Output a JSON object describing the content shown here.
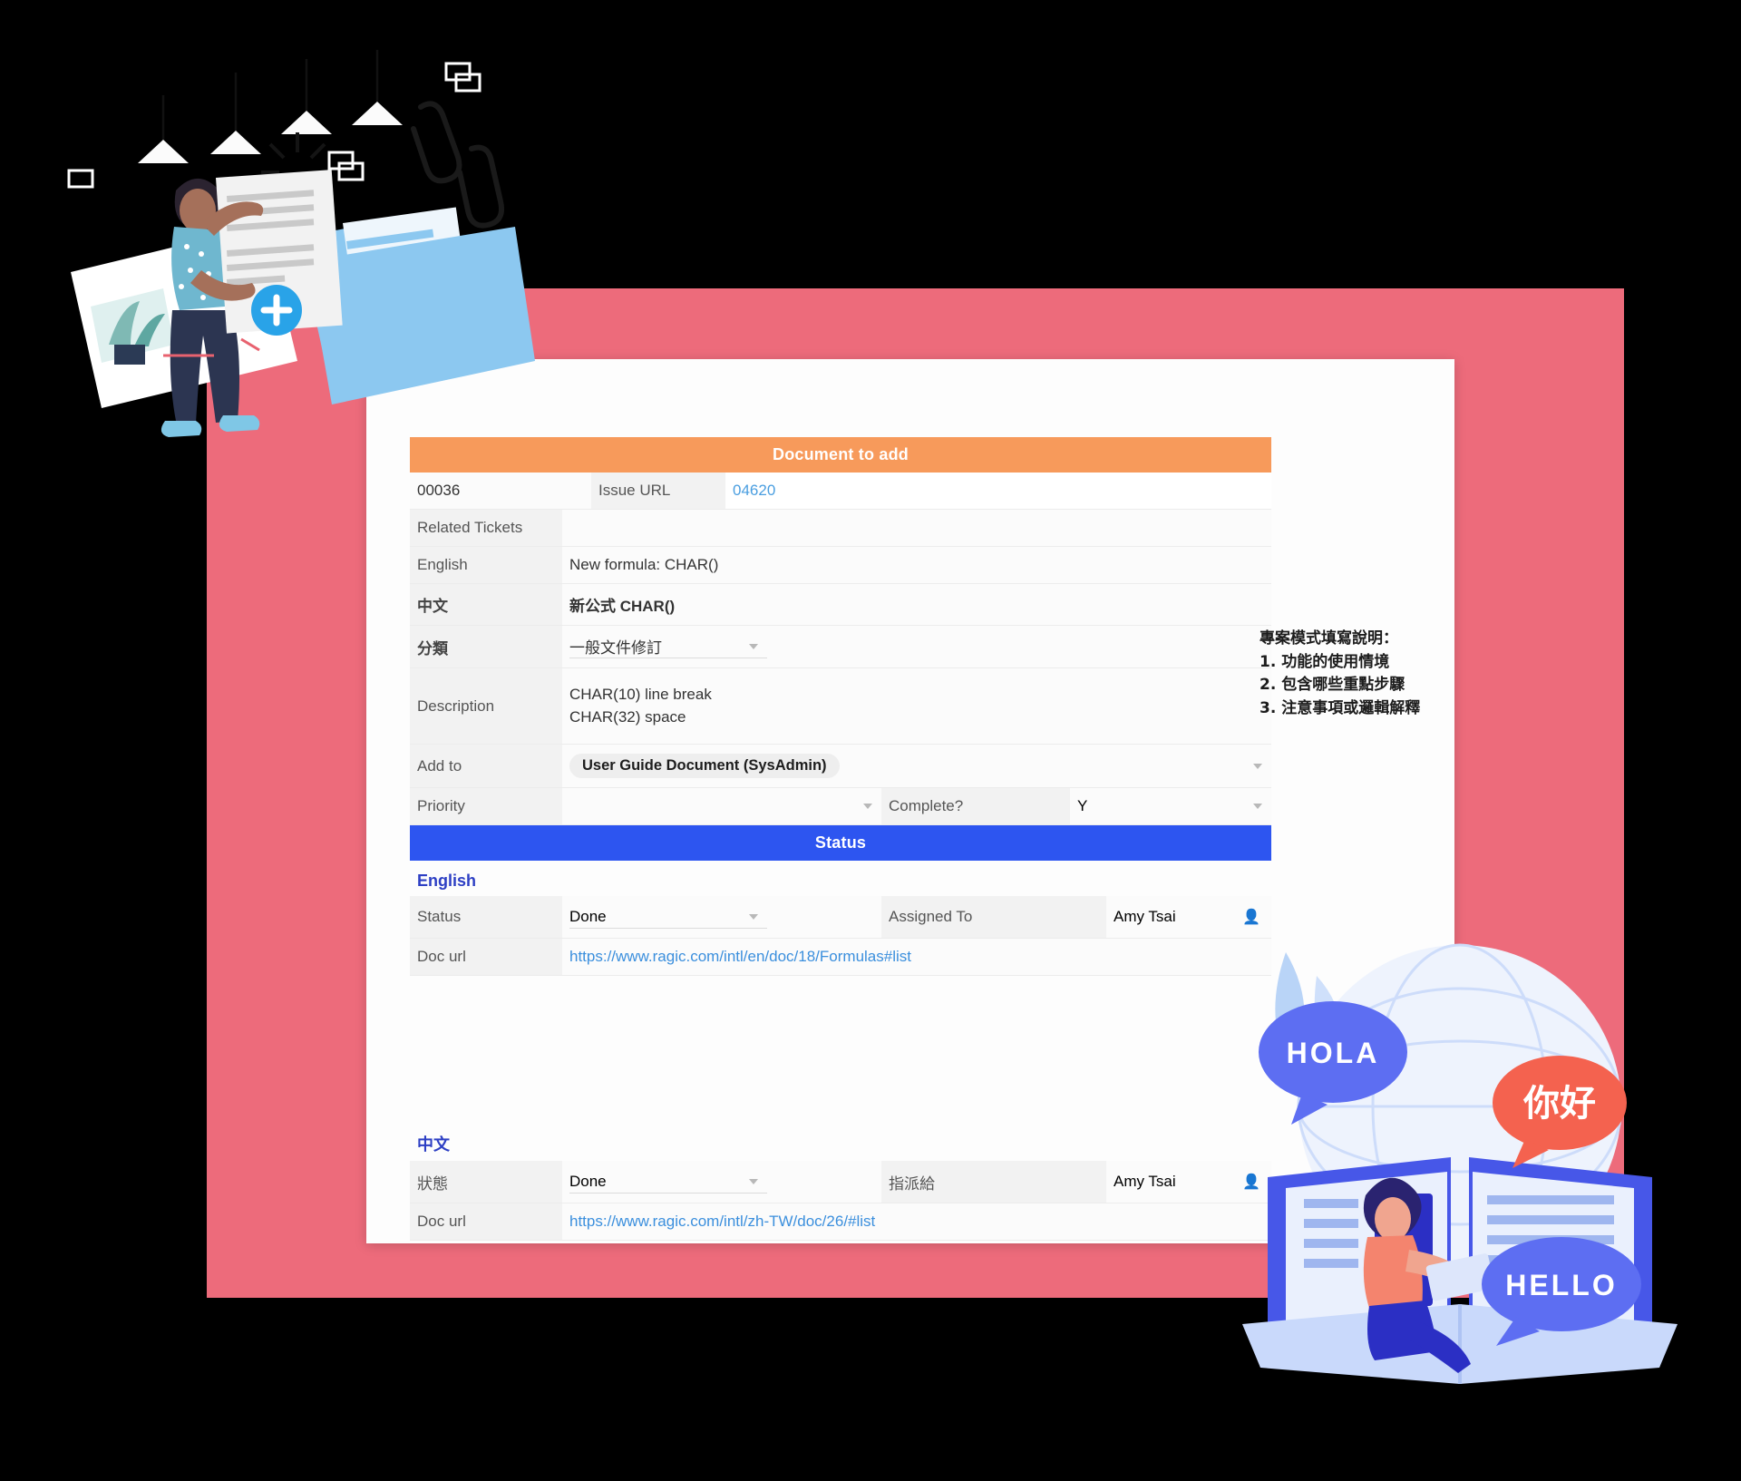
{
  "page": {
    "background_color": "#000000",
    "panel_color": "#ed6b7b",
    "card_color": "#fdfdfd"
  },
  "form": {
    "header_bar": "Document to add",
    "header_bar_color": "#f79a5b",
    "id_row": {
      "record_id": "00036",
      "issue_url_label": "Issue URL",
      "issue_url_value": "04620"
    },
    "rows": [
      {
        "label": "Related Tickets",
        "value": ""
      },
      {
        "label": "English",
        "value": "New formula: CHAR()"
      },
      {
        "label": "中文",
        "value": "新公式 CHAR()"
      }
    ],
    "category": {
      "label": "分類",
      "value": "一般文件修訂"
    },
    "description": {
      "label": "Description",
      "line1": "CHAR(10) line break",
      "line2": "CHAR(32) space"
    },
    "add_to": {
      "label": "Add to",
      "value": "User Guide Document (SysAdmin)"
    },
    "priority": {
      "label": "Priority",
      "value": ""
    },
    "complete": {
      "label": "Complete?",
      "value": "Y"
    },
    "status_bar": "Status",
    "status_bar_color": "#2d55f0",
    "sections": [
      {
        "heading": "English",
        "status_label": "Status",
        "status_value": "Done",
        "assigned_label": "Assigned To",
        "assigned_value": "Amy Tsai",
        "doc_url_label": "Doc url",
        "doc_url_value": "https://www.ragic.com/intl/en/doc/18/Formulas#list"
      },
      {
        "heading": "中文",
        "status_label": "狀態",
        "status_value": "Done",
        "assigned_label": "指派給",
        "assigned_value": "Amy Tsai",
        "doc_url_label": "Doc url",
        "doc_url_value": "https://www.ragic.com/intl/zh-TW/doc/26/#list"
      }
    ]
  },
  "note": {
    "title": "專案模式填寫說明：",
    "items": [
      "1. 功能的使用情境",
      "2. 包含哪些重點步驟",
      "3. 注意事項或邏輯解釋"
    ]
  },
  "illustration_language": {
    "bubble_hola": "HOLA",
    "bubble_nihao": "你好",
    "bubble_hello": "HELLO"
  },
  "colors": {
    "link": "#3b8fdd",
    "accent_orange": "#f79a5b",
    "accent_blue": "#2d55f0",
    "panel_pink": "#ed6b7b",
    "sublabel_blue": "#2d3fc4"
  }
}
